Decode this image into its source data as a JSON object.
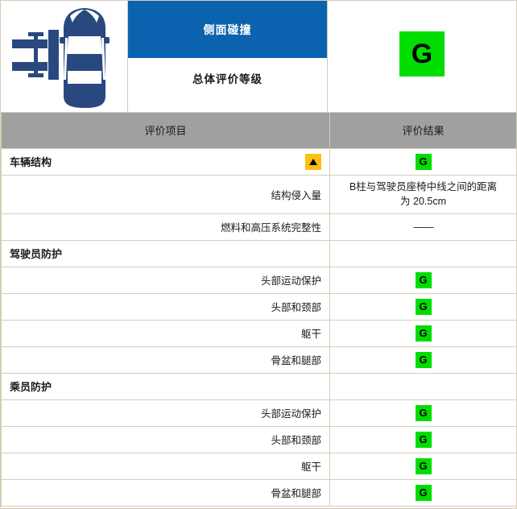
{
  "banner": {
    "test_title": "侧面碰撞",
    "overall_label": "总体评价等级",
    "overall_grade": "G",
    "illustration_name": "side-impact-barrier-car-diagram",
    "colors": {
      "title_bar": "#0b62ae",
      "grade_good": "#00dd00",
      "grade_warn": "#fdc010",
      "car": "#2a4880",
      "header_gray": "#a0a0a0",
      "border": "#d5cdba"
    }
  },
  "table": {
    "headers": {
      "item": "评价项目",
      "result": "评价结果"
    },
    "rows": [
      {
        "type": "section",
        "label": "车辆结构",
        "badge": "warn-triangle",
        "result": "G",
        "result_type": "grade"
      },
      {
        "type": "item",
        "label": "结构侵入量",
        "result": "B柱与驾驶员座椅中线之间的距离为 20.5cm",
        "result_type": "text",
        "tall": true
      },
      {
        "type": "item",
        "label": "燃料和高压系统完整性",
        "result": "——",
        "result_type": "dash"
      },
      {
        "type": "section",
        "label": "驾驶员防护",
        "result": "",
        "result_type": "empty"
      },
      {
        "type": "item",
        "label": "头部运动保护",
        "result": "G",
        "result_type": "grade"
      },
      {
        "type": "item",
        "label": "头部和颈部",
        "result": "G",
        "result_type": "grade"
      },
      {
        "type": "item",
        "label": "躯干",
        "result": "G",
        "result_type": "grade"
      },
      {
        "type": "item",
        "label": "骨盆和腿部",
        "result": "G",
        "result_type": "grade"
      },
      {
        "type": "section",
        "label": "乘员防护",
        "result": "",
        "result_type": "empty"
      },
      {
        "type": "item",
        "label": "头部运动保护",
        "result": "G",
        "result_type": "grade"
      },
      {
        "type": "item",
        "label": "头部和颈部",
        "result": "G",
        "result_type": "grade"
      },
      {
        "type": "item",
        "label": "躯干",
        "result": "G",
        "result_type": "grade"
      },
      {
        "type": "item",
        "label": "骨盆和腿部",
        "result": "G",
        "result_type": "grade"
      }
    ]
  }
}
